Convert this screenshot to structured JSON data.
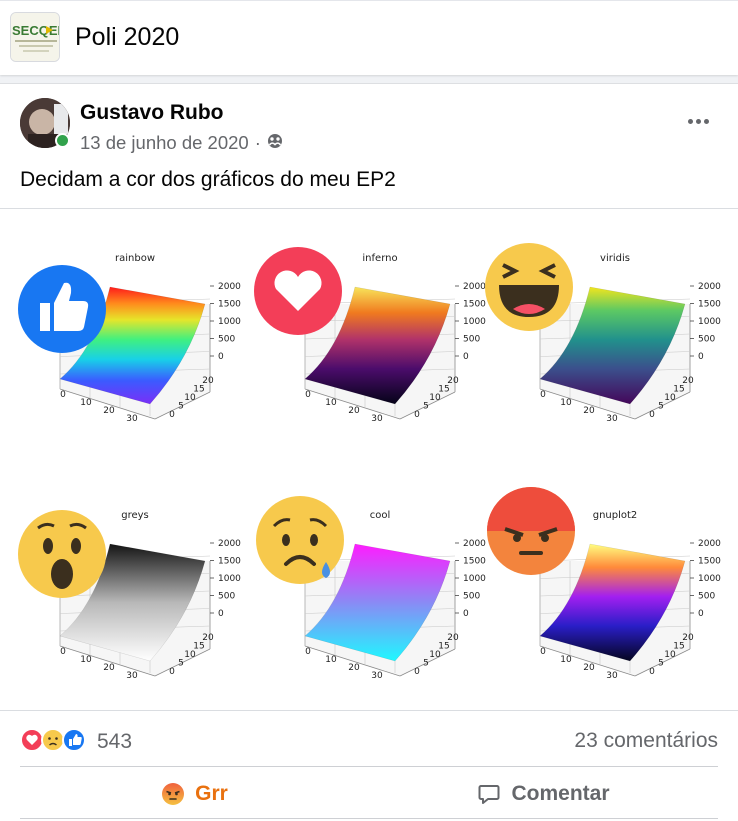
{
  "group": {
    "logo_text": "SECQEP",
    "name": "Poli 2020"
  },
  "post": {
    "author": "Gustavo Rubo",
    "date": "13 de junho de 2020",
    "separator": "·",
    "text": "Decidam a cor dos gráficos do meu EP2",
    "privacy_icon": "group-audience-icon"
  },
  "chart_image": {
    "panels": [
      {
        "title": "rainbow",
        "reaction": "like"
      },
      {
        "title": "inferno",
        "reaction": "love"
      },
      {
        "title": "viridis",
        "reaction": "haha"
      },
      {
        "title": "greys",
        "reaction": "wow"
      },
      {
        "title": "cool",
        "reaction": "sad"
      },
      {
        "title": "gnuplot2",
        "reaction": "angry"
      }
    ],
    "z_ticks": [
      "2000",
      "1500",
      "1000",
      "500",
      "0"
    ],
    "x_ticks": [
      "0",
      "10",
      "20",
      "30"
    ],
    "y_ticks": [
      "0",
      "5",
      "10",
      "15",
      "20"
    ]
  },
  "stats": {
    "reaction_count": "543",
    "comments": "23 comentários"
  },
  "actions": {
    "grr_label": "Grr",
    "comment_label": "Comentar"
  },
  "colors": {
    "grr": "#e9710f",
    "like": "#1877f2",
    "love": "#f33e58",
    "emoji": "#f7c94c",
    "angry": "#e9710f"
  }
}
